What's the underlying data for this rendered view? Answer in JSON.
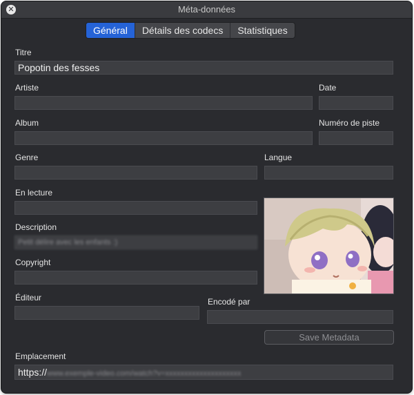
{
  "window": {
    "title": "Méta-données"
  },
  "tabs": [
    {
      "label": "Général",
      "active": true
    },
    {
      "label": "Détails des codecs",
      "active": false
    },
    {
      "label": "Statistiques",
      "active": false
    }
  ],
  "fields": {
    "title": {
      "label": "Titre",
      "value": "Popotin des fesses"
    },
    "artist": {
      "label": "Artiste",
      "value": ""
    },
    "date": {
      "label": "Date",
      "value": ""
    },
    "album": {
      "label": "Album",
      "value": ""
    },
    "track_number": {
      "label": "Numéro de piste",
      "value": ""
    },
    "genre": {
      "label": "Genre",
      "value": ""
    },
    "language": {
      "label": "Langue",
      "value": ""
    },
    "now_playing": {
      "label": "En lecture",
      "value": ""
    },
    "description": {
      "label": "Description",
      "value": "Petit délire avec les enfants :)"
    },
    "copyright": {
      "label": "Copyright",
      "value": ""
    },
    "publisher": {
      "label": "Éditeur",
      "value": ""
    },
    "encoded_by": {
      "label": "Encodé par",
      "value": ""
    },
    "location": {
      "label": "Emplacement",
      "value_prefix": "https://",
      "value_rest": "www.exemple-video.com/watch?v=xxxxxxxxxxxxxxxxxxxx"
    }
  },
  "save_button": {
    "label": "Save Metadata"
  },
  "colors": {
    "accent": "#2563d7",
    "background": "#2a2b2f",
    "field": "#3d3e42"
  },
  "icons": {
    "close": "close-icon"
  }
}
